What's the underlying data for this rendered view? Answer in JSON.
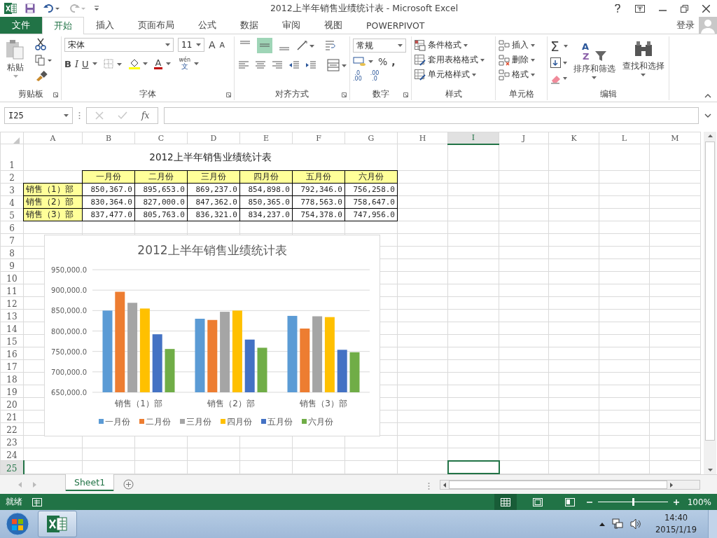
{
  "window": {
    "title": "2012上半年销售业绩统计表 - Microsoft Excel"
  },
  "tabs": [
    {
      "label": "文件",
      "kind": "file",
      "selected": false
    },
    {
      "label": "开始",
      "kind": "tab",
      "selected": true
    },
    {
      "label": "插入",
      "kind": "tab",
      "selected": false
    },
    {
      "label": "页面布局",
      "kind": "tab",
      "selected": false
    },
    {
      "label": "公式",
      "kind": "tab",
      "selected": false
    },
    {
      "label": "数据",
      "kind": "tab",
      "selected": false
    },
    {
      "label": "审阅",
      "kind": "tab",
      "selected": false
    },
    {
      "label": "视图",
      "kind": "tab",
      "selected": false
    },
    {
      "label": "POWERPIVOT",
      "kind": "tab",
      "selected": false
    }
  ],
  "account": {
    "label": "登录"
  },
  "ribbon": {
    "clipboard": {
      "label": "剪贴板",
      "paste": "粘贴"
    },
    "font": {
      "label": "字体",
      "font_name": "宋体",
      "font_size": "11",
      "grow": "A",
      "shrink": "A",
      "bold": "B",
      "italic": "I",
      "underline": "U",
      "font_color": "A",
      "phonetic_top": "wén",
      "phonetic_bottom": "文"
    },
    "alignment": {
      "label": "对齐方式",
      "vertical": [
        {
          "selected": false
        },
        {
          "selected": true
        },
        {
          "selected": false
        }
      ]
    },
    "number": {
      "label": "数字",
      "format": "常规",
      "percent": "%",
      "comma": ",",
      "increase_decimal": [
        ".0",
        ".00"
      ],
      "decrease_decimal": [
        ".00",
        ".0"
      ]
    },
    "styles": {
      "label": "样式",
      "items": [
        "条件格式",
        "套用表格格式",
        "单元格样式"
      ]
    },
    "cells": {
      "label": "单元格",
      "items": [
        "插入",
        "删除",
        "格式"
      ]
    },
    "editing": {
      "label": "编辑",
      "sum": "Σ",
      "sort_filter": {
        "label": "排序和筛选",
        "letters": [
          "A",
          "Z"
        ]
      },
      "find_select": "查找和选择"
    }
  },
  "formula_bar": {
    "name_box": "I25",
    "function_label": "fx"
  },
  "sheet": {
    "columns": [
      {
        "label": "A",
        "selected": false
      },
      {
        "label": "B",
        "selected": false
      },
      {
        "label": "C",
        "selected": false
      },
      {
        "label": "D",
        "selected": false
      },
      {
        "label": "E",
        "selected": false
      },
      {
        "label": "F",
        "selected": false
      },
      {
        "label": "G",
        "selected": false
      },
      {
        "label": "H",
        "selected": false
      },
      {
        "label": "I",
        "selected": true
      },
      {
        "label": "J",
        "selected": false
      },
      {
        "label": "K",
        "selected": false
      },
      {
        "label": "L",
        "selected": false
      },
      {
        "label": "M",
        "selected": false
      }
    ],
    "rows": [
      {
        "label": "1",
        "selected": false
      },
      {
        "label": "2",
        "selected": false
      },
      {
        "label": "3",
        "selected": false
      },
      {
        "label": "4",
        "selected": false
      },
      {
        "label": "5",
        "selected": false
      },
      {
        "label": "6",
        "selected": false
      },
      {
        "label": "7",
        "selected": false
      },
      {
        "label": "8",
        "selected": false
      },
      {
        "label": "9",
        "selected": false
      },
      {
        "label": "10",
        "selected": false
      },
      {
        "label": "11",
        "selected": false
      },
      {
        "label": "12",
        "selected": false
      },
      {
        "label": "13",
        "selected": false
      },
      {
        "label": "14",
        "selected": false
      },
      {
        "label": "15",
        "selected": false
      },
      {
        "label": "16",
        "selected": false
      },
      {
        "label": "17",
        "selected": false
      },
      {
        "label": "18",
        "selected": false
      },
      {
        "label": "19",
        "selected": false
      },
      {
        "label": "20",
        "selected": false
      },
      {
        "label": "21",
        "selected": false
      },
      {
        "label": "22",
        "selected": false
      },
      {
        "label": "23",
        "selected": false
      },
      {
        "label": "24",
        "selected": false
      },
      {
        "label": "25",
        "selected": true
      }
    ],
    "title": "2012上半年销售业绩统计表",
    "header_row": [
      "一月份",
      "二月份",
      "三月份",
      "四月份",
      "五月份",
      "六月份"
    ],
    "data_rows": [
      {
        "label": "销售（1）部",
        "values": [
          "850,367.0",
          "895,653.0",
          "869,237.0",
          "854,898.0",
          "792,346.0",
          "756,258.0"
        ]
      },
      {
        "label": "销售（2）部",
        "values": [
          "830,364.0",
          "827,000.0",
          "847,362.0",
          "850,365.0",
          "778,563.0",
          "758,647.0"
        ]
      },
      {
        "label": "销售（3）部",
        "values": [
          "837,477.0",
          "805,763.0",
          "836,321.0",
          "834,237.0",
          "754,378.0",
          "747,956.0"
        ]
      }
    ]
  },
  "chart": {
    "chart_data": {
      "type": "bar",
      "title": "2012上半年销售业绩统计表",
      "categories": [
        "销售（1）部",
        "销售（2）部",
        "销售（3）部"
      ],
      "series": [
        {
          "name": "一月份",
          "color": "#5b9bd5",
          "values": [
            850000,
            830000,
            837000
          ]
        },
        {
          "name": "二月份",
          "color": "#ed7d31",
          "values": [
            896000,
            827000,
            806000
          ]
        },
        {
          "name": "三月份",
          "color": "#a5a5a5",
          "values": [
            869000,
            847000,
            836000
          ]
        },
        {
          "name": "四月份",
          "color": "#ffc000",
          "values": [
            855000,
            850000,
            834000
          ]
        },
        {
          "name": "五月份",
          "color": "#4472c4",
          "values": [
            792000,
            779000,
            754000
          ]
        },
        {
          "name": "六月份",
          "color": "#70ad47",
          "values": [
            756000,
            759000,
            748000
          ]
        }
      ],
      "ylim": [
        650000,
        950000
      ],
      "yticks": [
        {
          "value": 650000,
          "label": "650,000.0"
        },
        {
          "value": 700000,
          "label": "700,000.0"
        },
        {
          "value": 750000,
          "label": "750,000.0"
        },
        {
          "value": 800000,
          "label": "800,000.0"
        },
        {
          "value": 850000,
          "label": "850,000.0"
        },
        {
          "value": 900000,
          "label": "900,000.0"
        },
        {
          "value": 950000,
          "label": "950,000.0"
        }
      ],
      "grid": true,
      "legend": true
    }
  },
  "sheet_tabs": [
    {
      "label": "Sheet1",
      "selected": true
    }
  ],
  "status_bar": {
    "status": "就绪",
    "views": [
      {
        "selected": true
      },
      {
        "selected": false
      },
      {
        "selected": false
      }
    ],
    "zoom": {
      "level": 0.5
    },
    "zoom_label": "100%"
  },
  "taskbar": {
    "time": "14:40",
    "date": "2015/1/19"
  }
}
